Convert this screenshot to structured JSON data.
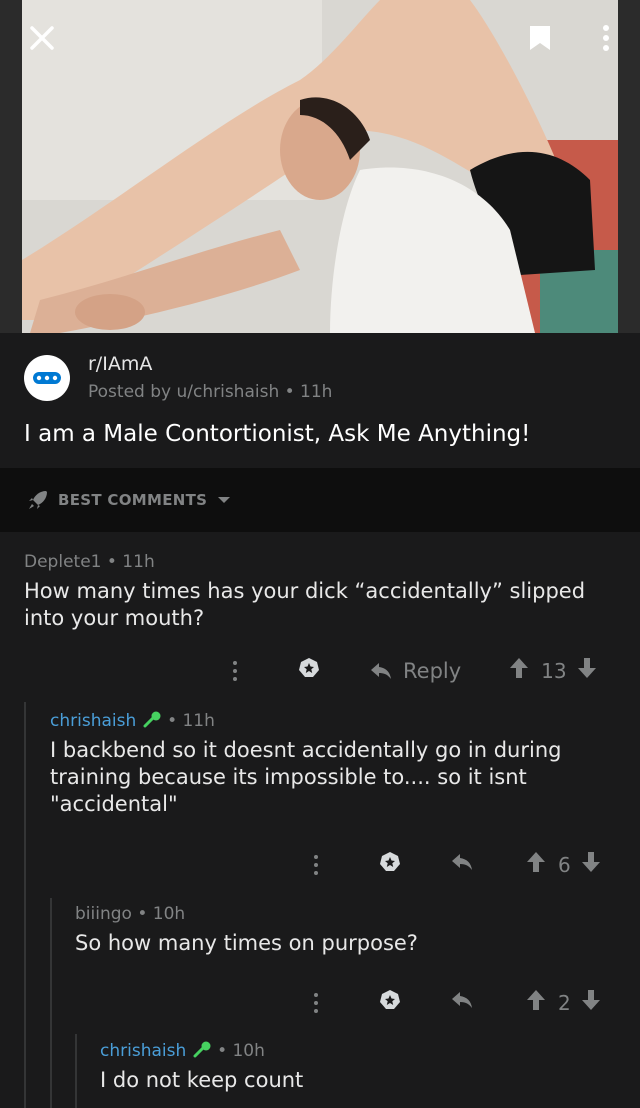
{
  "toolbar": {
    "close_icon": "close-icon",
    "save_icon": "bookmark-icon",
    "more_icon": "more-vertical-icon"
  },
  "post": {
    "subreddit": "r/IAmA",
    "meta": "Posted by u/chrishaish • 11h",
    "title": "I am a Male Contortionist, Ask Me Anything!"
  },
  "sort": {
    "label": "BEST COMMENTS"
  },
  "comments": [
    {
      "author": "Deplete1",
      "time": "• 11h",
      "body": "How many times has your dick “accidentally” slipped into your mouth?",
      "reply_label": "Reply",
      "score": "13"
    },
    {
      "author": "chrishaish",
      "time": "• 11h",
      "body": "I backbend so it doesnt accidentally go in during training because its impossible to.... so it isnt \"accidental\"",
      "score": "6"
    },
    {
      "author": "biiingo",
      "time": "• 10h",
      "body": "So how many times on purpose?",
      "score": "2"
    },
    {
      "author": "chrishaish",
      "time": "• 10h",
      "body": "I do not keep count"
    }
  ],
  "colors": {
    "background": "#1a1a1b",
    "op_author": "#4a9ed8",
    "muted": "#818384"
  }
}
